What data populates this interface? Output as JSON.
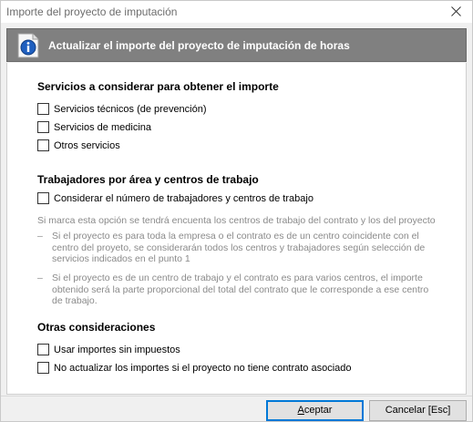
{
  "window": {
    "title": "Importe del proyecto de imputación"
  },
  "banner": {
    "title": "Actualizar el importe del proyecto de imputación de horas",
    "icon": "info-icon"
  },
  "services": {
    "heading": "Servicios a considerar para obtener el importe",
    "options": [
      {
        "label": "Servicios técnicos (de prevención)",
        "checked": false
      },
      {
        "label": "Servicios de medicina",
        "checked": false
      },
      {
        "label": "Otros servicios",
        "checked": false
      }
    ]
  },
  "workers": {
    "heading": "Trabajadores por área y centros de trabajo",
    "option": {
      "label": "Considerar el número de trabajadores y centros de trabajo",
      "checked": false
    },
    "note": "Si marca esta opción se tendrá encuenta los centros de trabajo del contrato y los del proyecto",
    "bullets": [
      "Si el proyecto es para toda la empresa o el contrato es de un centro coincidente con el centro del proyeto, se considerarán todos los centros y trabajadores según selección de servicios indicados en el punto 1",
      "Si el proyecto es de un centro de trabajo y el contrato es para varios centros, el importe obtenido será la parte proporcional del total del contrato que le corresponde a ese centro de trabajo."
    ],
    "bullet_marker": "–"
  },
  "other": {
    "heading": "Otras consideraciones",
    "options": [
      {
        "label": "Usar importes sin impuestos",
        "checked": false
      },
      {
        "label": "No actualizar los importes si el proyecto no tiene contrato asociado",
        "checked": false
      }
    ]
  },
  "buttons": {
    "accept_first": "A",
    "accept_rest": "ceptar",
    "cancel": "Cancelar [Esc]"
  },
  "colors": {
    "banner_bg": "#808080",
    "focus_border": "#0078d7",
    "note_text": "#8a8a8a"
  }
}
